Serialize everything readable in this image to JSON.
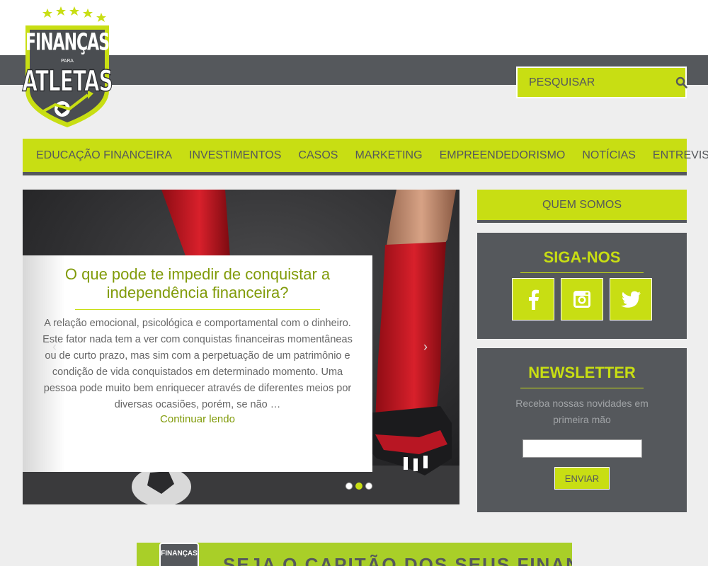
{
  "site": {
    "logo": {
      "line1": "FINANÇAS",
      "line2": "PARA",
      "line3": "ATLETAS"
    }
  },
  "search": {
    "placeholder": "PESQUISAR",
    "icon": "search-icon"
  },
  "nav": {
    "items": [
      {
        "label": "EDUCAÇÃO FINANCEIRA"
      },
      {
        "label": "INVESTIMENTOS"
      },
      {
        "label": "CASOS"
      },
      {
        "label": "MARKETING"
      },
      {
        "label": "EMPREENDEDORISMO"
      },
      {
        "label": "NOTÍCIAS"
      },
      {
        "label": "ENTREVISTAS"
      }
    ]
  },
  "hero": {
    "title": "O que pode te impedir de conquistar a independência financeira?",
    "excerpt": "A relação emocional, psicológica e comportamental com o dinheiro. Este fator nada tem a ver com conquistas financeiras momentâneas ou de curto prazo, mas sim com a perpetuação de um patrimônio e condição de vida conquistados em determinado momento. Uma pessoa pode muito bem enriquecer através de diferentes meios por diversas ocasiões, porém, se não …",
    "read_more": "Continuar lendo",
    "prev_arrow": "‹",
    "next_arrow": "›",
    "slide_count": 3,
    "active_slide": 2
  },
  "sidebar": {
    "about": "QUEM SOMOS",
    "follow": {
      "title": "SIGA-NOS",
      "networks": [
        {
          "icon": "facebook-icon"
        },
        {
          "icon": "instagram-icon"
        },
        {
          "icon": "twitter-icon"
        }
      ]
    },
    "newsletter": {
      "title": "NEWSLETTER",
      "text": "Receba nossas novidades em primeira mão",
      "button": "ENVIAR"
    }
  },
  "banner": {
    "logo": "FINANÇAS",
    "text": "SEJA O CAPITÃO DOS SEUS FINANÇAS!"
  },
  "colors": {
    "accent": "#c8de13",
    "dark": "#55585c",
    "title_green": "#819b0a",
    "sock_red": "#c41420"
  }
}
